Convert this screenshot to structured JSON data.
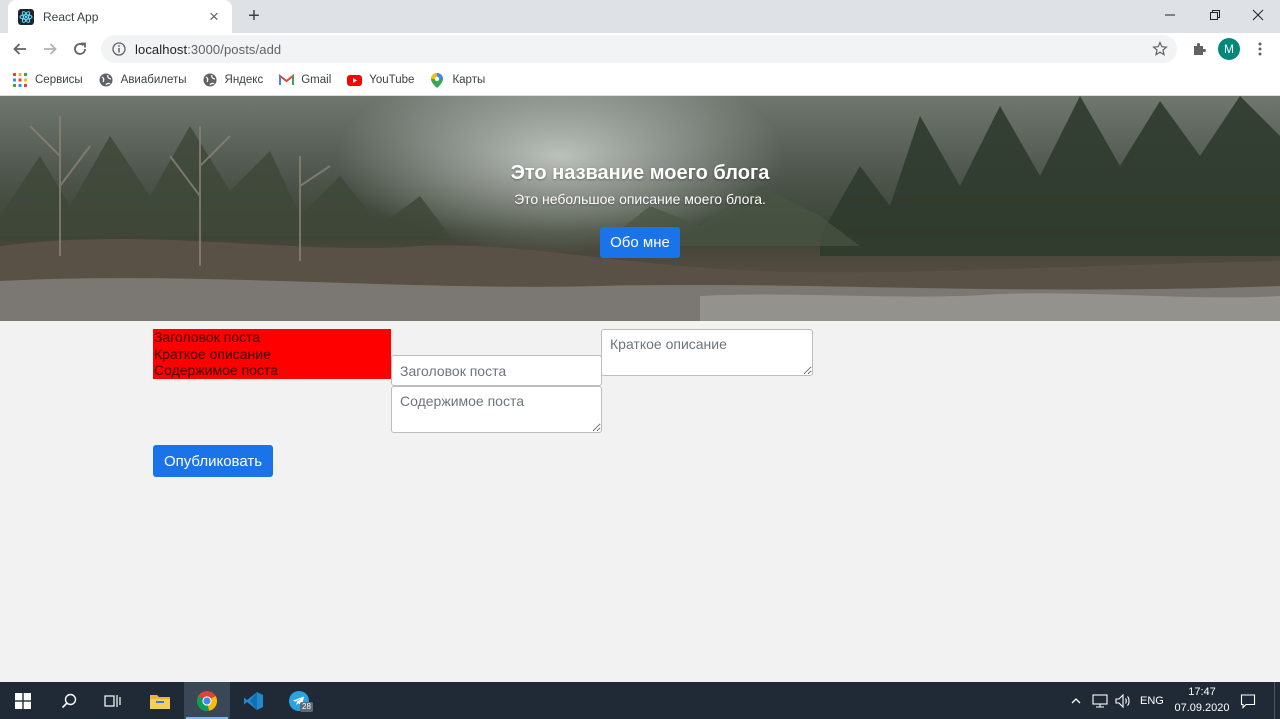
{
  "browser": {
    "tab_title": "React App",
    "new_tab_symbol": "+",
    "url_host": "localhost",
    "url_path": ":3000/posts/add",
    "avatar_letter": "M",
    "window_controls": [
      "minimize-icon",
      "restore-icon",
      "close-icon"
    ]
  },
  "bookmarks": [
    {
      "label": "Сервисы",
      "icon": "apps-grid-icon"
    },
    {
      "label": "Авиабилеты",
      "icon": "globe-icon"
    },
    {
      "label": "Яндекс",
      "icon": "globe-icon"
    },
    {
      "label": "Gmail",
      "icon": "gmail-icon"
    },
    {
      "label": "YouTube",
      "icon": "youtube-icon"
    },
    {
      "label": "Карты",
      "icon": "maps-pin-icon"
    }
  ],
  "hero": {
    "title": "Это название моего блога",
    "subtitle": "Это небольшое описание моего блога.",
    "about_button": "Обо мне"
  },
  "form": {
    "labels": [
      "Заголовок поста",
      "Краткое описание",
      "Содержимое поста"
    ],
    "title_placeholder": "Заголовок поста",
    "content_placeholder": "Содержимое поста",
    "summary_placeholder": "Краткое описание",
    "publish_button": "Опубликовать"
  },
  "taskbar": {
    "apps": [
      "windows-start-icon",
      "search-icon",
      "task-view-icon",
      "file-explorer-icon",
      "chrome-icon",
      "vscode-icon",
      "telegram-icon"
    ],
    "telegram_badge": "28",
    "language": "ENG",
    "time": "17:47",
    "date": "07.09.2020"
  },
  "colors": {
    "accent": "#1a73e8",
    "labels_bg": "#ff0000",
    "page_bg": "#f2f2f2",
    "taskbar_bg": "#1f2a36"
  }
}
